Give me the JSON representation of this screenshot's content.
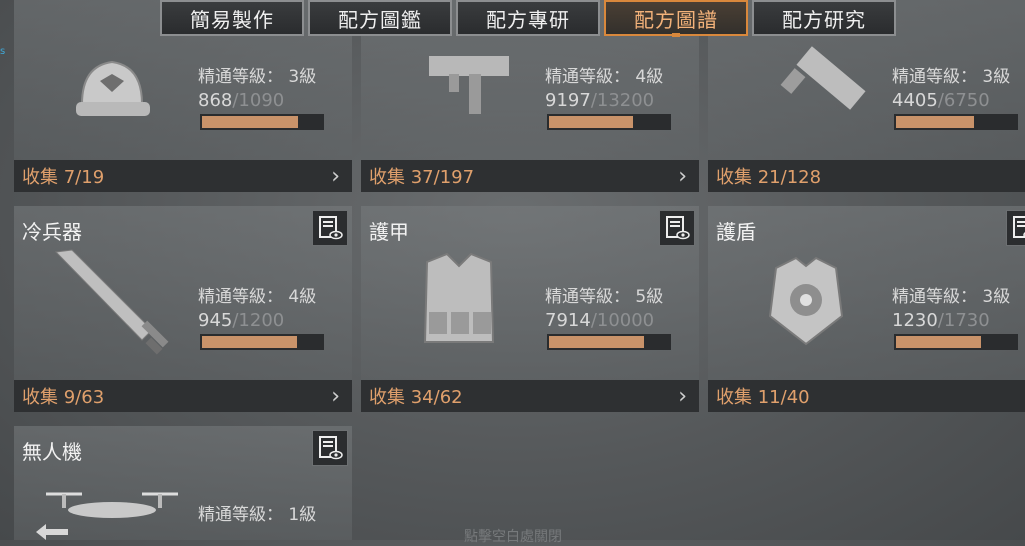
{
  "tabs": [
    {
      "label": "簡易製作"
    },
    {
      "label": "配方圖鑑"
    },
    {
      "label": "配方專研"
    },
    {
      "label": "配方圖譜"
    },
    {
      "label": "配方研究"
    }
  ],
  "cards": [
    {
      "title": "",
      "mastery": "精通等級： 3級",
      "exp_cur": "868",
      "exp_max": "/1090",
      "progress": 0.796,
      "collect": "收集 7/19",
      "icon": "cap-icon"
    },
    {
      "title": "",
      "mastery": "精通等級： 4級",
      "exp_cur": "9197",
      "exp_max": "/13200",
      "progress": 0.697,
      "collect": "收集 37/197",
      "icon": "smg-icon"
    },
    {
      "title": "",
      "mastery": "精通等級： 3級",
      "exp_cur": "4405",
      "exp_max": "/6750",
      "progress": 0.653,
      "collect": "收集 21/128",
      "icon": "launcher-icon"
    },
    {
      "title": "冷兵器",
      "mastery": "精通等級： 4級",
      "exp_cur": "945",
      "exp_max": "/1200",
      "progress": 0.7875,
      "collect": "收集 9/63",
      "icon": "sword-icon"
    },
    {
      "title": "護甲",
      "mastery": "精通等級： 5級",
      "exp_cur": "7914",
      "exp_max": "/10000",
      "progress": 0.7914,
      "collect": "收集 34/62",
      "icon": "vest-icon"
    },
    {
      "title": "護盾",
      "mastery": "精通等級： 3級",
      "exp_cur": "1230",
      "exp_max": "/1730",
      "progress": 0.711,
      "collect": "收集 11/40",
      "icon": "shield-armor-icon"
    },
    {
      "title": "無人機",
      "mastery": "精通等級： 1級",
      "exp_cur": "",
      "exp_max": "",
      "progress": 0,
      "collect": "",
      "icon": "drone-icon"
    }
  ],
  "footer": {
    "hint": "點擊空白處關閉"
  },
  "colors": {
    "accent": "#d9883c",
    "collect_text": "#e0a06c",
    "bar_fill": "#c9936a"
  }
}
